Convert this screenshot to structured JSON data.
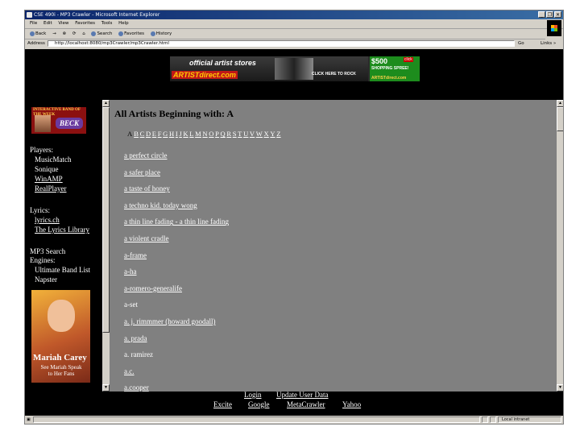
{
  "window": {
    "title": "CSE 490i - MP3 Crawler - Microsoft Internet Explorer",
    "controls": [
      "_",
      "❐",
      "✕"
    ]
  },
  "menu": [
    "File",
    "Edit",
    "View",
    "Favorites",
    "Tools",
    "Help"
  ],
  "toolbar": {
    "back": "Back",
    "forward": "→",
    "stop": "⊗",
    "refresh": "⟳",
    "home": "⌂",
    "search": "Search",
    "favorites": "Favorites",
    "history": "History"
  },
  "address": {
    "label": "Address",
    "url": "http://localhost:8080/mp3Crawler/mp3Crawler.html",
    "go": "Go",
    "links": "Links »"
  },
  "banner": {
    "line1": "official artist stores",
    "brand": "ARTISTdirect.com",
    "cta": "CLICK HERE TO ROCK",
    "promo_amount": "$500",
    "promo_text": "SHOPPING SPREE!",
    "promo_click": "click",
    "promo_site": "ARTISTdirect.com"
  },
  "sidebar": {
    "band_week": "INTERACTIVE BAND OF THE WEEK",
    "band_name": "BECK",
    "players_heading": "Players:",
    "players": [
      "MusicMatch",
      "Sonique",
      "WinAMP",
      "RealPlayer"
    ],
    "lyrics_heading": "Lyrics:",
    "lyrics": [
      "lyrics.ch",
      "The Lyrics Library"
    ],
    "engines_heading_1": "MP3 Search",
    "engines_heading_2": "Engines:",
    "engines": [
      "Ultimate Band List",
      "Napster"
    ],
    "ad_name": "Mariah Carey",
    "ad_sub_1": "See Mariah Speak",
    "ad_sub_2": "to Her Fans"
  },
  "main": {
    "heading": "All Artists Beginning with: A",
    "current_letter": "A",
    "letters": [
      "B",
      "C",
      "D",
      "E",
      "F",
      "G",
      "H",
      "I",
      "J",
      "K",
      "L",
      "M",
      "N",
      "O",
      "P",
      "Q",
      "R",
      "S",
      "T",
      "U",
      "V",
      "W",
      "X",
      "Y",
      "Z"
    ],
    "artists": [
      "a perfect circle",
      "a safer place",
      "a taste of honey",
      "a techno kid. today wong",
      "a thin line fading - a thin line fading",
      "a violent cradle",
      "a-frame",
      "a-ha",
      "a-romero-generalife",
      "a-set",
      "a. j. rimmmer (howard goodall)",
      "a. prada",
      "a. ramirez",
      "a.c.",
      "a.cooper"
    ]
  },
  "footer": {
    "login": "Login",
    "update": "Update User Data",
    "links": [
      "Excite",
      "Google",
      "MetaCrawler",
      "Yahoo"
    ]
  },
  "status": {
    "zone": "Local intranet"
  }
}
